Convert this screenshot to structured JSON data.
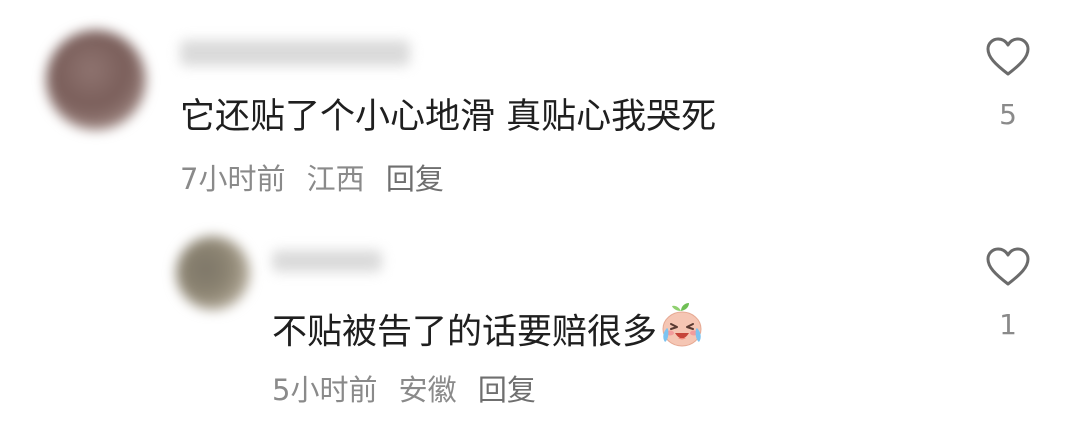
{
  "comments": [
    {
      "text": "它还贴了个小心地滑 真贴心我哭死",
      "time": "7小时前",
      "location": "江西",
      "reply_label": "回复",
      "likes": "5"
    },
    {
      "text": "不贴被告了的话要赔很多",
      "emoji_icon": "crying-laughing-peach-icon",
      "time": "5小时前",
      "location": "安徽",
      "reply_label": "回复",
      "likes": "1"
    }
  ],
  "colors": {
    "text": "#1f1f1f",
    "meta": "#8a8a8a",
    "icon": "#6b6b6b"
  }
}
